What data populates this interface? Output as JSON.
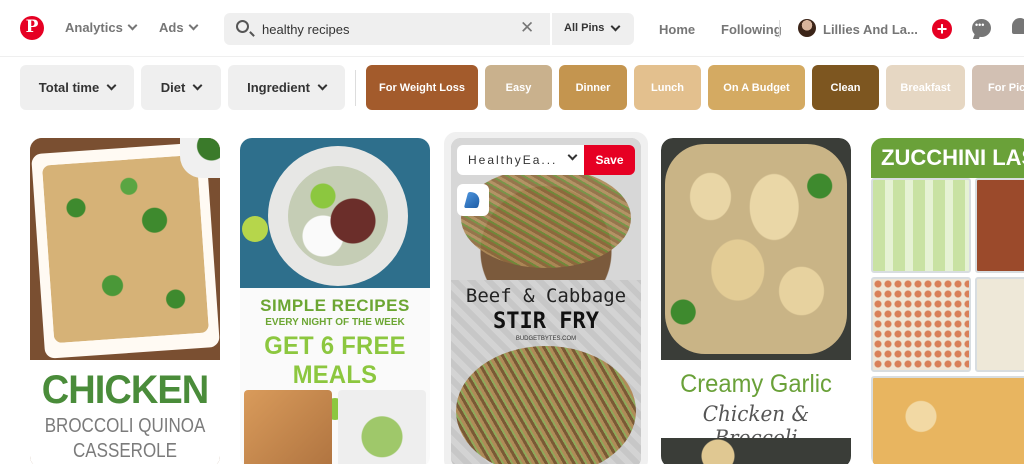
{
  "header": {
    "logo_letter": "P",
    "nav": [
      {
        "label": "Analytics"
      },
      {
        "label": "Ads"
      }
    ],
    "search": {
      "query": "healthy recipes",
      "scope": "All Pins"
    },
    "links": {
      "home": "Home",
      "following": "Following",
      "profile": "Lillies And La..."
    }
  },
  "filters": [
    {
      "label": "Total time"
    },
    {
      "label": "Diet"
    },
    {
      "label": "Ingredient"
    }
  ],
  "chips": [
    {
      "label": "For Weight Loss",
      "color": "#a35b2c"
    },
    {
      "label": "Easy",
      "color": "#c9b18d"
    },
    {
      "label": "Dinner",
      "color": "#c4954f"
    },
    {
      "label": "Lunch",
      "color": "#e3c08e"
    },
    {
      "label": "On A Budget",
      "color": "#d4aa62"
    },
    {
      "label": "Clean",
      "color": "#7d5620"
    },
    {
      "label": "Breakfast",
      "color": "#e6d7c3"
    },
    {
      "label": "For Pic",
      "color": "#d2c0b3"
    }
  ],
  "pins": {
    "p1": {
      "line1": "CHICKEN",
      "line2": "BROCCOLI QUINOA",
      "line3": "CASSEROLE"
    },
    "p2": {
      "line1": "SIMPLE RECIPES",
      "line2": "EVERY NIGHT OF THE WEEK",
      "line3": "GET 6 FREE MEALS"
    },
    "p3": {
      "line1": "Beef & Cabbage",
      "line2": "STIR FRY",
      "line3": "BUDGETBYTES.COM",
      "board": "HealthyEa...",
      "save": "Save"
    },
    "p4": {
      "line1": "Creamy Garlic",
      "line2": "Chicken & Broccoli"
    },
    "p5": {
      "line1": "ZUCCHINI LASAGNA"
    }
  },
  "colors": {
    "brand": "#e60023",
    "chip_text": "#ffffff"
  }
}
